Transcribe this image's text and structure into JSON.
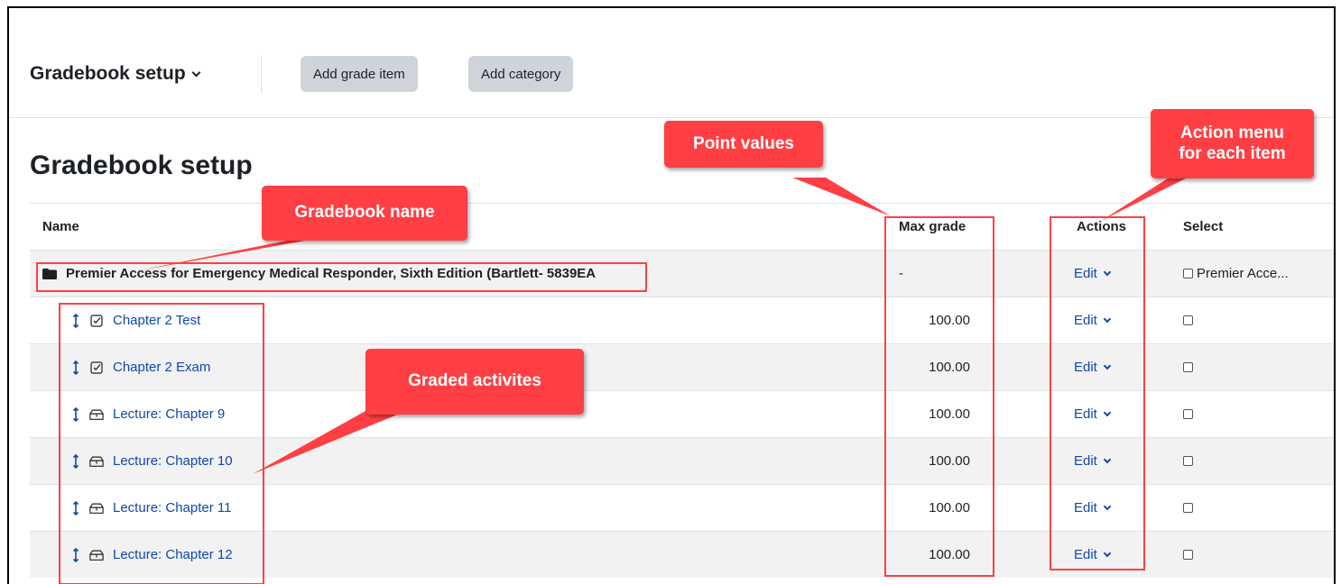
{
  "nav": {
    "title": "Gradebook setup",
    "add_grade_item": "Add grade item",
    "add_category": "Add category"
  },
  "page": {
    "heading": "Gradebook setup"
  },
  "table": {
    "headers": {
      "name": "Name",
      "max_grade": "Max grade",
      "actions": "Actions",
      "select": "Select"
    },
    "category": {
      "name": "Premier Access for Emergency Medical Responder, Sixth Edition (Bartlett- 5839EA",
      "max_grade": "-",
      "action": "Edit",
      "select_label": "Premier Acce..."
    },
    "items": [
      {
        "name": "Chapter 2 Test",
        "icon": "quiz-icon",
        "max_grade": "100.00",
        "action": "Edit"
      },
      {
        "name": "Chapter 2 Exam",
        "icon": "quiz-icon",
        "max_grade": "100.00",
        "action": "Edit"
      },
      {
        "name": "Lecture: Chapter 9",
        "icon": "lesson-icon",
        "max_grade": "100.00",
        "action": "Edit"
      },
      {
        "name": "Lecture: Chapter 10",
        "icon": "lesson-icon",
        "max_grade": "100.00",
        "action": "Edit"
      },
      {
        "name": "Lecture: Chapter 11",
        "icon": "lesson-icon",
        "max_grade": "100.00",
        "action": "Edit"
      },
      {
        "name": "Lecture: Chapter 12",
        "icon": "lesson-icon",
        "max_grade": "100.00",
        "action": "Edit"
      }
    ]
  },
  "annotations": {
    "point_values": "Point values",
    "action_menu_line1": "Action menu",
    "action_menu_line2": "for each item",
    "gradebook_name": "Gradebook name",
    "graded_activities": "Graded activites",
    "color": "#ff3f44"
  }
}
